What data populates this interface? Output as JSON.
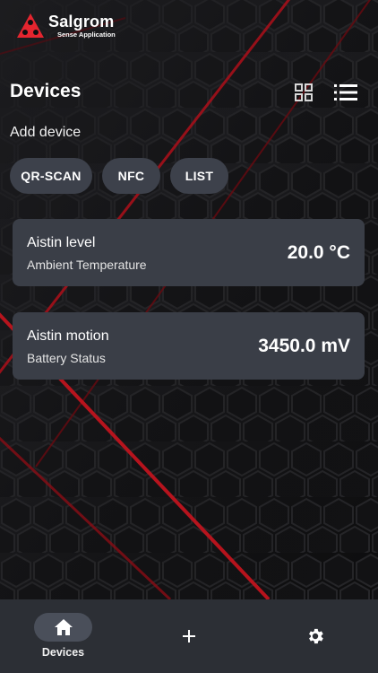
{
  "brand": {
    "name": "Salgrom",
    "subtitle": "Sense Application",
    "logo_color": "#e4252f"
  },
  "header": {
    "title": "Devices",
    "grid_view_icon": "grid-icon",
    "list_view_icon": "list-icon"
  },
  "add_device": {
    "label": "Add device",
    "buttons": [
      {
        "label": "QR-SCAN"
      },
      {
        "label": "NFC"
      },
      {
        "label": "LIST"
      }
    ]
  },
  "devices": [
    {
      "name": "Aistin level",
      "type": "Ambient Temperature",
      "value": "20.0 °C"
    },
    {
      "name": "Aistin motion",
      "type": "Battery Status",
      "value": "3450.0 mV"
    }
  ],
  "bottom_nav": {
    "items": [
      {
        "label": "Devices",
        "icon": "home-icon",
        "active": true
      },
      {
        "label": "",
        "icon": "plus-icon",
        "active": false
      },
      {
        "label": "",
        "icon": "gear-icon",
        "active": false
      }
    ]
  },
  "colors": {
    "card_bg": "#3a3e47",
    "chip_bg": "#3d414b",
    "nav_bg": "#2c2f35",
    "accent_red": "#c8141e"
  }
}
